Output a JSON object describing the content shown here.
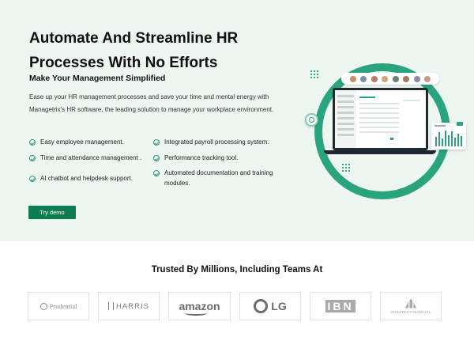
{
  "hero": {
    "title": "Automate And Streamline HR Processes With No Efforts",
    "subtitle": "Make Your Management Simplified",
    "description": "Ease up your HR management processes and save your time and mental energy with Managetrix's HR software, the leading solution to manage your workplace environment.",
    "features_left": [
      "Easy employee management.",
      "Time and attendance management .",
      "AI chatbot and helpdesk support."
    ],
    "features_right": [
      "Integrated payroll processing system.",
      "Performance tracking tool.",
      "Automated documentation and training modules."
    ],
    "cta_label": "Try demo"
  },
  "trusted": {
    "heading": "Trusted By Millions, Including Teams At",
    "logos": [
      {
        "name": "prudential",
        "text": "Prudential"
      },
      {
        "name": "harris",
        "text": "HARRIS"
      },
      {
        "name": "amazon",
        "text": "amazon"
      },
      {
        "name": "lg",
        "text": "LG"
      },
      {
        "name": "ibn",
        "text": "IBN"
      },
      {
        "name": "choate",
        "text": "CHOATES FINANCIAL"
      }
    ]
  },
  "colors": {
    "accent": "#0c7d51",
    "hero_bg": "#eef6f2",
    "ring": "#2aa37f"
  }
}
